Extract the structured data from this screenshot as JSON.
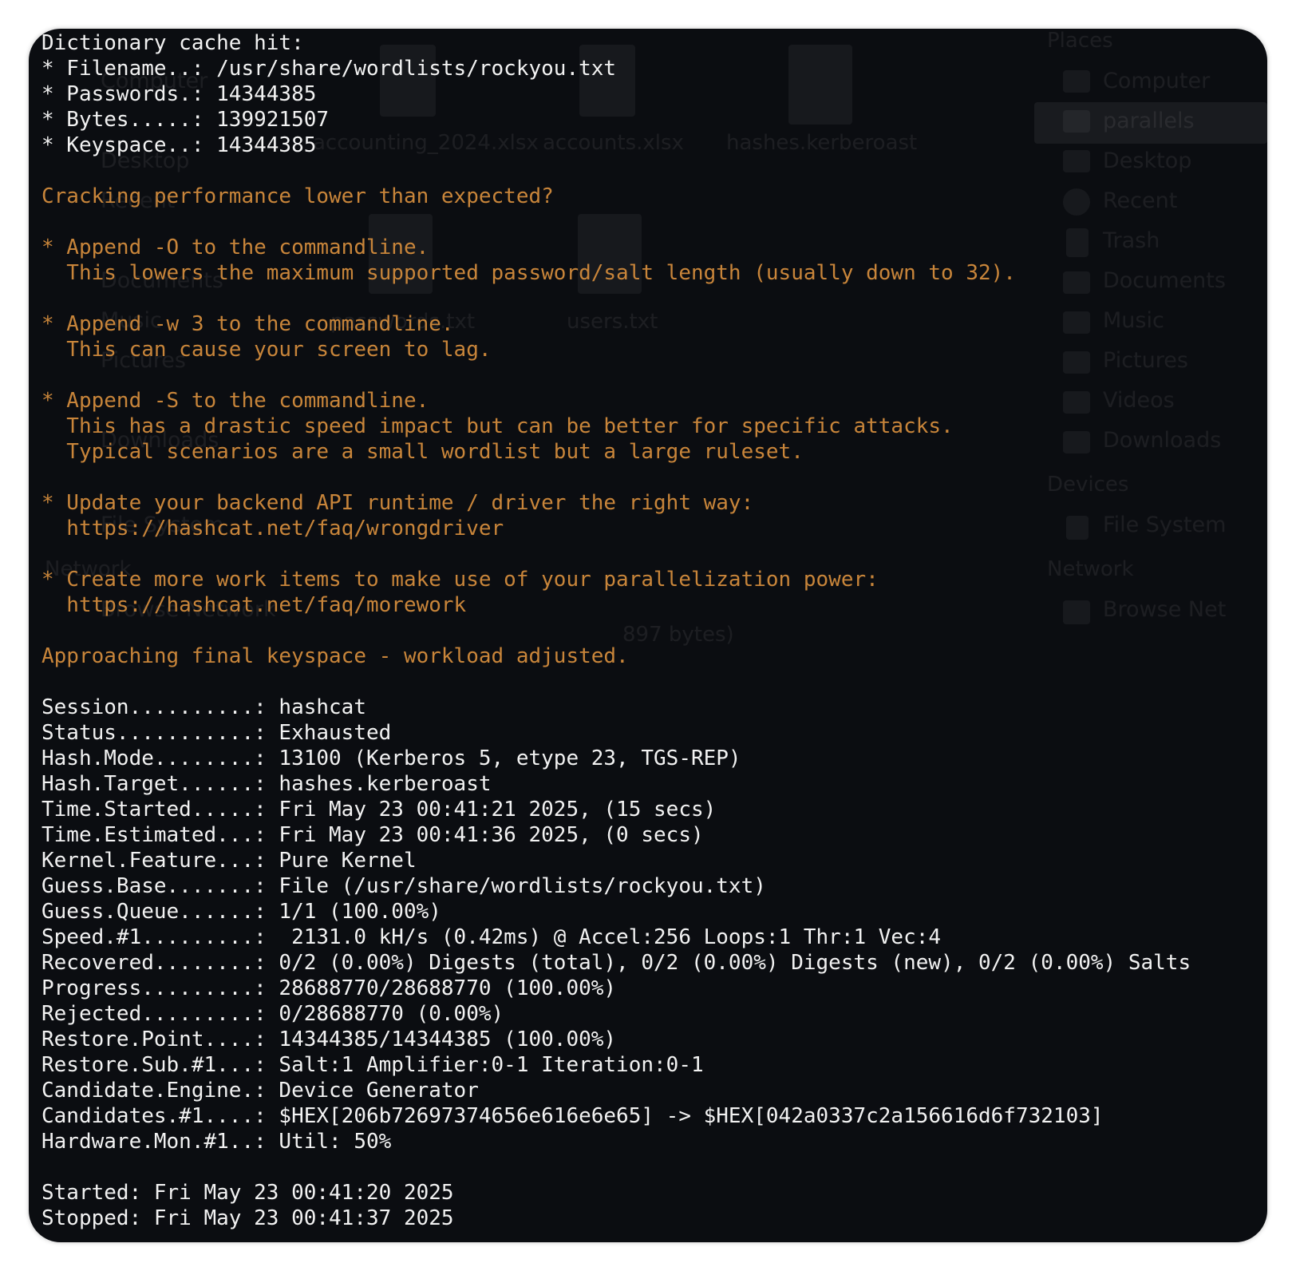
{
  "block1": [
    {
      "text": "Dictionary cache hit:",
      "tone": "white"
    },
    {
      "text": "* Filename..: /usr/share/wordlists/rockyou.txt",
      "tone": "white"
    },
    {
      "text": "* Passwords.: 14344385",
      "tone": "white"
    },
    {
      "text": "* Bytes.....: 139921507",
      "tone": "white"
    },
    {
      "text": "* Keyspace..: 14344385",
      "tone": "white"
    },
    {
      "text": "",
      "tone": "white"
    },
    {
      "text": "Cracking performance lower than expected?",
      "tone": "orange"
    },
    {
      "text": "",
      "tone": "orange"
    },
    {
      "text": "* Append -O to the commandline.",
      "tone": "orange"
    },
    {
      "text": "  This lowers the maximum supported password/salt length (usually down to 32).",
      "tone": "orange"
    },
    {
      "text": "",
      "tone": "orange"
    },
    {
      "text": "* Append -w 3 to the commandline.",
      "tone": "orange"
    },
    {
      "text": "  This can cause your screen to lag.",
      "tone": "orange"
    },
    {
      "text": "",
      "tone": "orange"
    },
    {
      "text": "* Append -S to the commandline.",
      "tone": "orange"
    },
    {
      "text": "  This has a drastic speed impact but can be better for specific attacks.",
      "tone": "orange"
    },
    {
      "text": "  Typical scenarios are a small wordlist but a large ruleset.",
      "tone": "orange"
    },
    {
      "text": "",
      "tone": "orange"
    },
    {
      "text": "* Update your backend API runtime / driver the right way:",
      "tone": "orange"
    },
    {
      "text": "  https://hashcat.net/faq/wrongdriver",
      "tone": "orange"
    },
    {
      "text": "",
      "tone": "orange"
    },
    {
      "text": "* Create more work items to make use of your parallelization power:",
      "tone": "orange"
    },
    {
      "text": "  https://hashcat.net/faq/morework",
      "tone": "orange"
    },
    {
      "text": "",
      "tone": "orange"
    },
    {
      "text": "Approaching final keyspace - workload adjusted.",
      "tone": "orange"
    },
    {
      "text": "",
      "tone": "white"
    },
    {
      "text": "Session..........: hashcat",
      "tone": "white"
    },
    {
      "text": "Status...........: Exhausted",
      "tone": "white"
    },
    {
      "text": "Hash.Mode........: 13100 (Kerberos 5, etype 23, TGS-REP)",
      "tone": "white"
    },
    {
      "text": "Hash.Target......: hashes.kerberoast",
      "tone": "white"
    },
    {
      "text": "Time.Started.....: Fri May 23 00:41:21 2025, (15 secs)",
      "tone": "white"
    },
    {
      "text": "Time.Estimated...: Fri May 23 00:41:36 2025, (0 secs)",
      "tone": "white"
    },
    {
      "text": "Kernel.Feature...: Pure Kernel",
      "tone": "white"
    },
    {
      "text": "Guess.Base.......: File (/usr/share/wordlists/rockyou.txt)",
      "tone": "white"
    },
    {
      "text": "Guess.Queue......: 1/1 (100.00%)",
      "tone": "white"
    },
    {
      "text": "Speed.#1.........:  2131.0 kH/s (0.42ms) @ Accel:256 Loops:1 Thr:1 Vec:4",
      "tone": "white"
    },
    {
      "text": "Recovered........: 0/2 (0.00%) Digests (total), 0/2 (0.00%) Digests (new), 0/2 (0.00%) Salts",
      "tone": "white"
    },
    {
      "text": "Progress.........: 28688770/28688770 (100.00%)",
      "tone": "white"
    },
    {
      "text": "Rejected.........: 0/28688770 (0.00%)",
      "tone": "white"
    },
    {
      "text": "Restore.Point....: 14344385/14344385 (100.00%)",
      "tone": "white"
    },
    {
      "text": "Restore.Sub.#1...: Salt:1 Amplifier:0-1 Iteration:0-1",
      "tone": "white"
    },
    {
      "text": "Candidate.Engine.: Device Generator",
      "tone": "white"
    },
    {
      "text": "Candidates.#1....: $HEX[206b72697374656e616e6e65] -> $HEX[042a0337c2a156616d6f732103]",
      "tone": "white"
    },
    {
      "text": "Hardware.Mon.#1..: Util: 50%",
      "tone": "white"
    },
    {
      "text": "",
      "tone": "white"
    },
    {
      "text": "Started: Fri May 23 00:41:20 2025",
      "tone": "white"
    },
    {
      "text": "Stopped: Fri May 23 00:41:37 2025",
      "tone": "white"
    }
  ],
  "background": {
    "places_header": "Places",
    "places": [
      "Computer",
      "parallels",
      "Desktop",
      "Recent",
      "Trash",
      "Documents",
      "Music",
      "Pictures",
      "Videos",
      "Downloads"
    ],
    "devices_header": "Devices",
    "devices": [
      "File System"
    ],
    "network_header": "Network",
    "network": [
      "Browse Net"
    ],
    "files": [
      "accounting_2024.xlsx",
      "accounts.xlsx",
      "hashes.kerberoast",
      "passwords.txt",
      "users.txt"
    ],
    "left_items": [
      "Computer",
      "Desktop",
      "Recent",
      "Documents",
      "Music",
      "Pictures",
      "Downloads",
      "File System",
      "Network",
      "Browse Network"
    ],
    "status_fragment": "897 bytes)"
  },
  "colors": {
    "terminal_bg": "#0b0d11",
    "text_white": "#f2f2f2",
    "text_orange": "#c8853a"
  }
}
